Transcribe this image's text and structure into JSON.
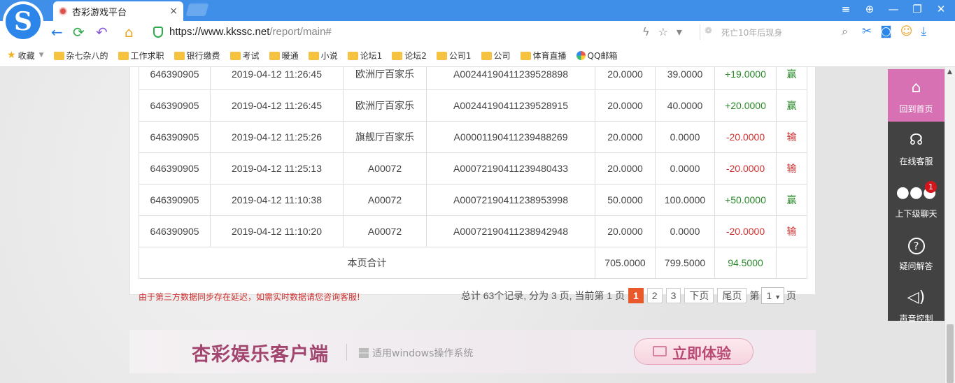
{
  "browser": {
    "tab_title": "杏彩游戏平台",
    "tab_close": "×",
    "url_host": "https://www.kkssc.net",
    "url_path": "/report/main#",
    "search_placeholder": "死亡10年后现身",
    "window_controls": [
      "≡",
      "⊕",
      "—",
      "❐",
      "✕"
    ]
  },
  "bookmarks": [
    {
      "label": "收藏",
      "icon": "star-icon"
    },
    {
      "label": "杂七杂八的",
      "icon": "folder-icon"
    },
    {
      "label": "工作求职",
      "icon": "folder-icon"
    },
    {
      "label": "银行缴费",
      "icon": "folder-icon"
    },
    {
      "label": "考试",
      "icon": "folder-icon"
    },
    {
      "label": "暖通",
      "icon": "folder-icon"
    },
    {
      "label": "小说",
      "icon": "folder-icon"
    },
    {
      "label": "论坛1",
      "icon": "folder-icon"
    },
    {
      "label": "论坛2",
      "icon": "folder-icon"
    },
    {
      "label": "公司1",
      "icon": "folder-icon"
    },
    {
      "label": "公司",
      "icon": "folder-icon"
    },
    {
      "label": "体育直播",
      "icon": "folder-icon"
    },
    {
      "label": "QQ邮箱",
      "icon": "qq-mail-icon"
    }
  ],
  "records": [
    {
      "id": "646390905",
      "time": "2019-04-12 11:26:45",
      "room": "欧洲厅百家乐",
      "order": "A00244190411239528898",
      "bet": "20.0000",
      "payout": "39.0000",
      "winloss": "+19.0000",
      "result": "赢",
      "positive": true
    },
    {
      "id": "646390905",
      "time": "2019-04-12 11:26:45",
      "room": "欧洲厅百家乐",
      "order": "A00244190411239528915",
      "bet": "20.0000",
      "payout": "40.0000",
      "winloss": "+20.0000",
      "result": "赢",
      "positive": true
    },
    {
      "id": "646390905",
      "time": "2019-04-12 11:25:26",
      "room": "旗舰厅百家乐",
      "order": "A00001190411239488269",
      "bet": "20.0000",
      "payout": "0.0000",
      "winloss": "-20.0000",
      "result": "输",
      "positive": false
    },
    {
      "id": "646390905",
      "time": "2019-04-12 11:25:13",
      "room": "A00072",
      "order": "A00072190411239480433",
      "bet": "20.0000",
      "payout": "0.0000",
      "winloss": "-20.0000",
      "result": "输",
      "positive": false
    },
    {
      "id": "646390905",
      "time": "2019-04-12 11:10:38",
      "room": "A00072",
      "order": "A00072190411238953998",
      "bet": "50.0000",
      "payout": "100.0000",
      "winloss": "+50.0000",
      "result": "赢",
      "positive": true
    },
    {
      "id": "646390905",
      "time": "2019-04-12 11:10:20",
      "room": "A00072",
      "order": "A00072190411238942948",
      "bet": "20.0000",
      "payout": "0.0000",
      "winloss": "-20.0000",
      "result": "输",
      "positive": false
    }
  ],
  "totals": {
    "label": "本页合计",
    "bet": "705.0000",
    "payout": "799.5000",
    "winloss": "94.5000"
  },
  "notice": "由于第三方数据同步存在延迟，如需实时数据请您咨询客服!",
  "pager": {
    "summary": "总计 63个记录, 分为 3 页, 当前第 1 页",
    "pages": [
      "1",
      "2",
      "3"
    ],
    "current": "1",
    "next": "下页",
    "last": "尾页",
    "goto_prefix": "第",
    "goto_value": "1",
    "goto_suffix": "页"
  },
  "banner": {
    "title": "杏彩娱乐客户端",
    "subtitle": "适用windows操作系统",
    "button": "立即体验"
  },
  "sidebar": [
    {
      "label": "回到首页",
      "icon": "home-icon",
      "glyph": "⌂"
    },
    {
      "label": "在线客服",
      "icon": "headset-24-icon",
      "glyph": "☊"
    },
    {
      "label": "上下级聊天",
      "icon": "chat-bubble-icon",
      "glyph": "💬",
      "badge": "1"
    },
    {
      "label": "疑问解答",
      "icon": "question-icon",
      "glyph": "?"
    },
    {
      "label": "声音控制",
      "icon": "speaker-icon",
      "glyph": "🔈"
    }
  ],
  "colors": {
    "accent": "#e8592b",
    "positive": "#2a8a2a",
    "negative": "#d12f2f",
    "sidebar_home": "#d871b4",
    "sidebar_bg": "#424242",
    "browser_blue": "#3f8ee7"
  }
}
